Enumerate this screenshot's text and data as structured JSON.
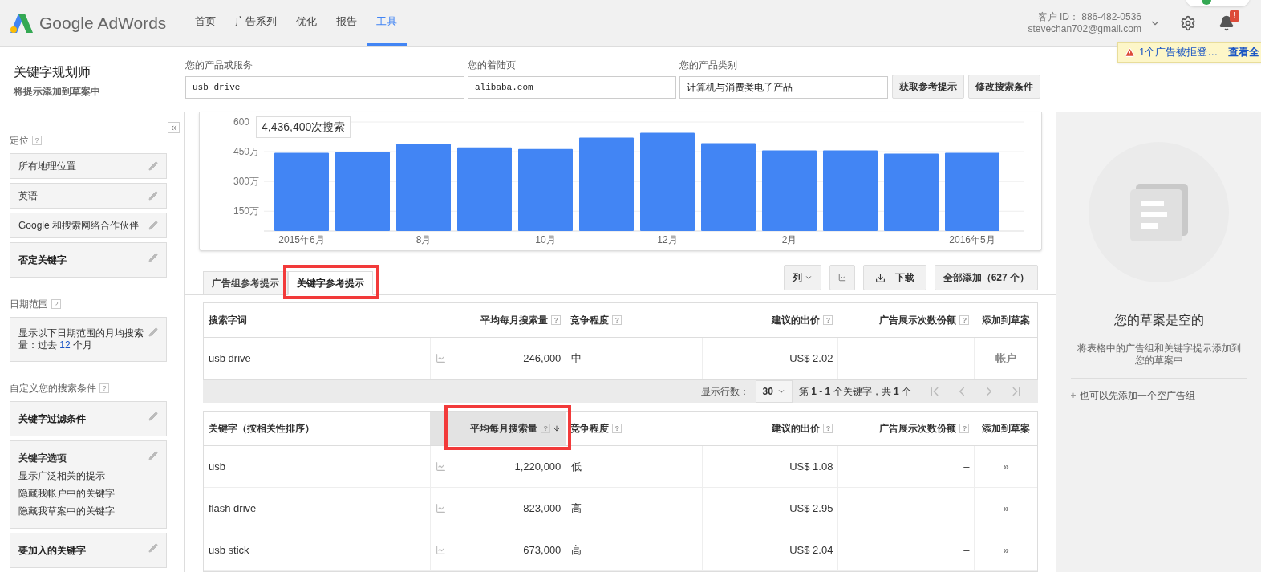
{
  "nav": {
    "logo": "Google AdWords",
    "tabs": [
      {
        "label": "首页",
        "selected": false
      },
      {
        "label": "广告系列",
        "selected": false
      },
      {
        "label": "优化",
        "selected": false
      },
      {
        "label": "报告",
        "selected": false
      },
      {
        "label": "工具",
        "selected": true
      }
    ],
    "account": {
      "id_label": "客户 ID：",
      "id": "886-482-0536",
      "email": "stevechan702@gmail.com"
    },
    "bell_badge": "!",
    "notification": {
      "text": "1个广告被拒登…",
      "link": "查看全"
    }
  },
  "header": {
    "title": "关键字规划师",
    "subtitle": "将提示添加到草案中",
    "fields": [
      {
        "label": "您的产品或服务",
        "value": "usb drive",
        "kind": "mono"
      },
      {
        "label": "您的着陆页",
        "value": "alibaba.com",
        "kind": "mono"
      },
      {
        "label": "您的产品类别",
        "value": "计算机与消费类电子产品",
        "kind": "plain"
      }
    ],
    "buttons": [
      "获取参考提示",
      "修改搜索条件"
    ]
  },
  "sidebar": {
    "sections": [
      {
        "title": "定位",
        "help": "?",
        "items": [
          {
            "kind": "plain",
            "text": "所有地理位置"
          },
          {
            "kind": "plain",
            "text": "英语"
          },
          {
            "kind": "plain",
            "text": "Google 和搜索网络合作伙伴"
          },
          {
            "kind": "bold",
            "text": "否定关键字"
          }
        ]
      },
      {
        "title": "日期范围",
        "help": "?",
        "items": [
          {
            "kind": "range",
            "text": "显示以下日期范围的月均搜索量：过去",
            "value": "12",
            "suffix": "个月"
          }
        ]
      },
      {
        "title": "自定义您的搜索条件",
        "help": "?",
        "items": [
          {
            "kind": "bold",
            "text": "关键字过滤条件"
          },
          {
            "kind": "options",
            "text": "关键字选项",
            "lines": [
              "显示广泛相关的提示",
              "隐藏我帐户中的关键字",
              "隐藏我草案中的关键字"
            ]
          },
          {
            "kind": "bold",
            "text": "要加入的关键字"
          }
        ]
      }
    ]
  },
  "chart": {
    "tooltip": "4,436,400次搜索",
    "chart_data": {
      "type": "bar",
      "categories": [
        "2015年6月",
        null,
        "8月",
        null,
        "10月",
        null,
        "12月",
        null,
        "2月",
        null,
        null,
        "2016年5月"
      ],
      "series": [
        {
          "color": "#4285f4",
          "values": [
            444,
            448,
            489,
            472,
            464,
            521,
            545,
            493,
            456,
            456,
            440,
            444
          ]
        }
      ],
      "grid": true,
      "ylim": [
        50,
        600
      ],
      "yticks": [
        {
          "value": 150,
          "label": "150万"
        },
        {
          "value": 300,
          "label": "300万"
        },
        {
          "value": 450,
          "label": "450万"
        },
        {
          "value": 600,
          "label": "600"
        }
      ]
    }
  },
  "tabs": [
    {
      "label": "广告组参考提示",
      "selected": false,
      "highlighted": false
    },
    {
      "label": "关键字参考提示",
      "selected": true,
      "highlighted": true
    }
  ],
  "toolbar": {
    "columns": "列",
    "download": "下载",
    "add_all": "全部添加（627 个）"
  },
  "search_terms": {
    "columns": [
      {
        "label": "搜索字词",
        "sorted": false,
        "highlighted": false
      },
      {
        "label": "平均每月搜索量",
        "help": "?",
        "sorted": false,
        "highlighted": false
      },
      {
        "label": "竞争程度",
        "help": "?",
        "sorted": false,
        "highlighted": false
      },
      {
        "label": "建议的出价",
        "help": "?",
        "sorted": false,
        "highlighted": false
      },
      {
        "label": "广告展示次数份额",
        "help": "?",
        "sorted": false,
        "highlighted": false
      },
      {
        "label": "添加到草案",
        "sorted": false,
        "highlighted": false
      }
    ],
    "rows": [
      {
        "keyword": "usb drive",
        "searches": "246,000",
        "competition": "中",
        "bid": "US$ 2.02",
        "share": "–",
        "add": "帐户"
      }
    ]
  },
  "pager": {
    "label": "显示行数：",
    "rows": "30",
    "summary": "第 **1 - 1** 个关键字，共 **1** 个"
  },
  "keywords": {
    "columns": [
      {
        "label": "关键字（按相关性排序）",
        "sorted": false,
        "highlighted": false
      },
      {
        "label": "平均每月搜索量",
        "help": "?",
        "sorted": true,
        "highlighted": true
      },
      {
        "label": "竞争程度",
        "help": "?",
        "sorted": false,
        "highlighted": false
      },
      {
        "label": "建议的出价",
        "help": "?",
        "sorted": false,
        "highlighted": false
      },
      {
        "label": "广告展示次数份额",
        "help": "?",
        "sorted": false,
        "highlighted": false
      },
      {
        "label": "添加到草案",
        "sorted": false,
        "highlighted": false
      }
    ],
    "rows": [
      {
        "keyword": "usb",
        "searches": "1,220,000",
        "competition": "低",
        "bid": "US$ 1.08",
        "share": "–",
        "add": "»"
      },
      {
        "keyword": "flash drive",
        "searches": "823,000",
        "competition": "高",
        "bid": "US$ 2.95",
        "share": "–",
        "add": "»"
      },
      {
        "keyword": "usb stick",
        "searches": "673,000",
        "competition": "高",
        "bid": "US$ 2.04",
        "share": "–",
        "add": "»"
      }
    ]
  },
  "draft": {
    "title": "您的草案是空的",
    "description": "将表格中的广告组和关键字提示添加到您的草案中",
    "link_icon": "+",
    "link": "也可以先添加一个空广告组"
  }
}
